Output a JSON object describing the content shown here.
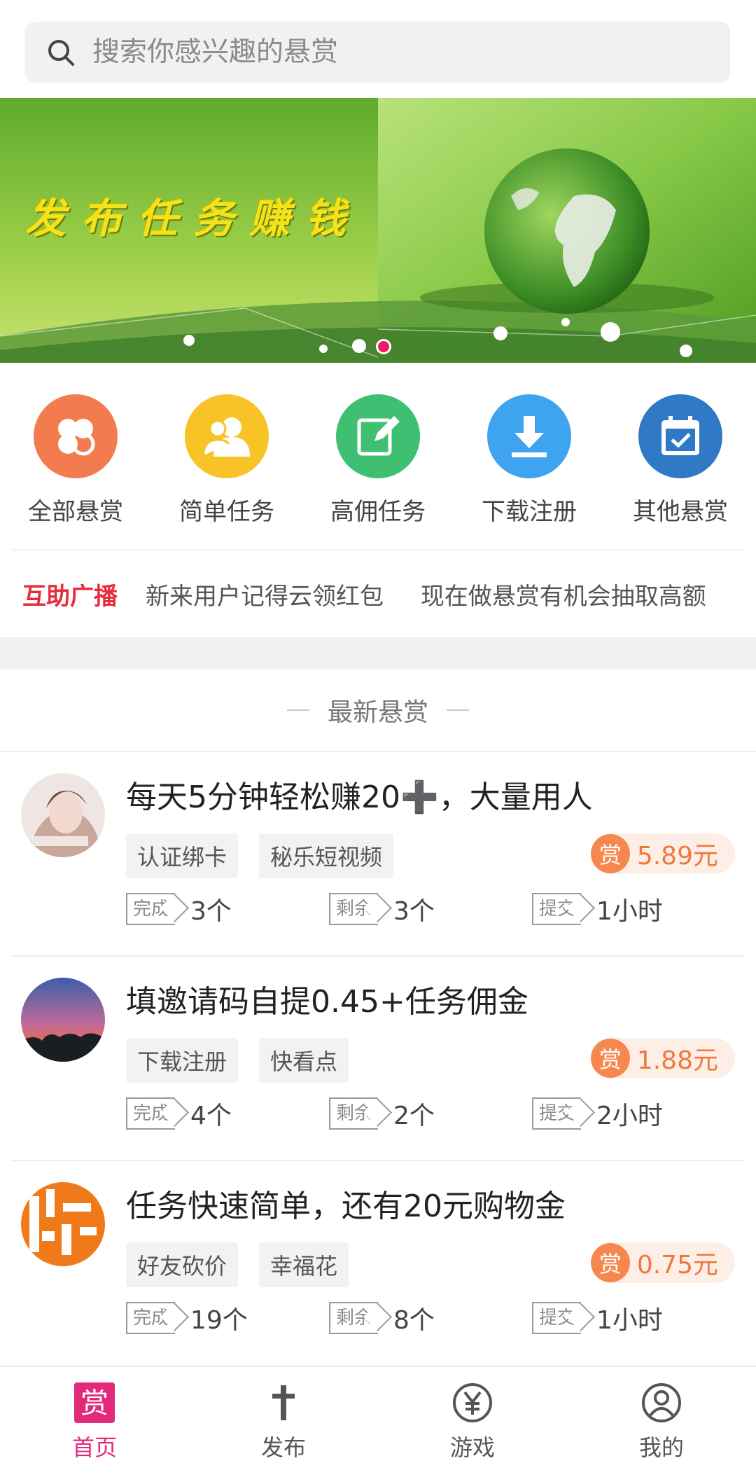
{
  "search": {
    "placeholder": "搜索你感兴趣的悬赏"
  },
  "banner": {
    "title": "发布任务赚钱",
    "slides": 2,
    "active_slide": 2
  },
  "categories": [
    {
      "label": "全部悬赏",
      "icon": "clover-icon",
      "color": "#f37c4f"
    },
    {
      "label": "简单任务",
      "icon": "users-icon",
      "color": "#f7c326"
    },
    {
      "label": "高佣任务",
      "icon": "edit-icon",
      "color": "#3fbf72"
    },
    {
      "label": "下载注册",
      "icon": "download-icon",
      "color": "#3fa4ef"
    },
    {
      "label": "其他悬赏",
      "icon": "calendar-check-icon",
      "color": "#2f79c6"
    }
  ],
  "broadcast": {
    "tag": "互助广播",
    "messages": [
      "新来用户记得云领红包",
      "现在做悬赏有机会抽取高额"
    ]
  },
  "section": {
    "title": "最新悬赏"
  },
  "tasks": [
    {
      "title": "每天5分钟轻松赚20➕，大量用人",
      "tags": [
        "认证绑卡",
        "秘乐短视频"
      ],
      "reward_badge": "赏",
      "reward": "5.89元",
      "stats": [
        {
          "label": "完成",
          "value": "3个"
        },
        {
          "label": "剩余",
          "value": "3个"
        },
        {
          "label": "提交",
          "value": "1小时"
        }
      ]
    },
    {
      "title": "填邀请码自提0.45+任务佣金",
      "tags": [
        "下载注册",
        "快看点"
      ],
      "reward_badge": "赏",
      "reward": "1.88元",
      "stats": [
        {
          "label": "完成",
          "value": "4个"
        },
        {
          "label": "剩余",
          "value": "2个"
        },
        {
          "label": "提交",
          "value": "2小时"
        }
      ]
    },
    {
      "title": "任务快速简单，还有20元购物金",
      "tags": [
        "好友砍价",
        "幸福花"
      ],
      "reward_badge": "赏",
      "reward": "0.75元",
      "stats": [
        {
          "label": "完成",
          "value": "19个"
        },
        {
          "label": "剩余",
          "value": "8个"
        },
        {
          "label": "提交",
          "value": "1小时"
        }
      ]
    }
  ],
  "bottom_nav": [
    {
      "label": "首页",
      "icon": "reward-badge-icon",
      "active": true
    },
    {
      "label": "发布",
      "icon": "cross-icon",
      "active": false
    },
    {
      "label": "游戏",
      "icon": "yen-coin-icon",
      "active": false
    },
    {
      "label": "我的",
      "icon": "user-circle-icon",
      "active": false
    }
  ],
  "colors": {
    "accent": "#e2297c",
    "reward": "#f0783f",
    "broadcast": "#e82c3c"
  }
}
